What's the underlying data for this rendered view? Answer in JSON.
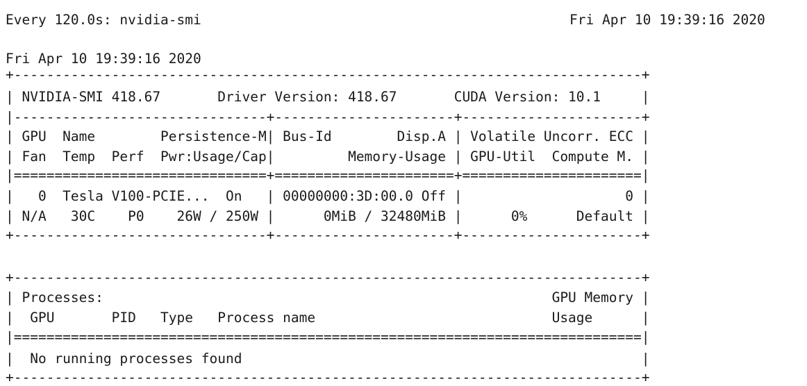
{
  "watch_header": {
    "left": "Every 120.0s: nvidia-smi",
    "right": "Fri Apr 10 19:39:16 2020"
  },
  "timestamp": "Fri Apr 10 19:39:16 2020",
  "gpu_table": {
    "border_top": "+-----------------------------------------------------------------------------+",
    "version_row": "| NVIDIA-SMI 418.67       Driver Version: 418.67       CUDA Version: 10.1     |",
    "separator_dash": "|-------------------------------+----------------------+----------------------+",
    "header_row_1": "| GPU  Name        Persistence-M| Bus-Id        Disp.A | Volatile Uncorr. ECC |",
    "header_row_2": "| Fan  Temp  Perf  Pwr:Usage/Cap|         Memory-Usage | GPU-Util  Compute M. |",
    "separator_equals": "|===============================+======================+======================|",
    "gpu_row_1": "|   0  Tesla V100-PCIE...  On   | 00000000:3D:00.0 Off |                    0 |",
    "gpu_row_2": "| N/A   30C    P0    26W / 250W |      0MiB / 32480MiB |      0%      Default |",
    "border_bottom": "+-------------------------------+----------------------+----------------------+"
  },
  "processes_table": {
    "border_top": "+-----------------------------------------------------------------------------+",
    "title_row": "| Processes:                                                       GPU Memory |",
    "header_row": "|  GPU       PID   Type   Process name                             Usage      |",
    "separator_equals": "|=============================================================================|",
    "message_row": "|  No running processes found                                                 |",
    "border_bottom": "+-----------------------------------------------------------------------------+"
  }
}
